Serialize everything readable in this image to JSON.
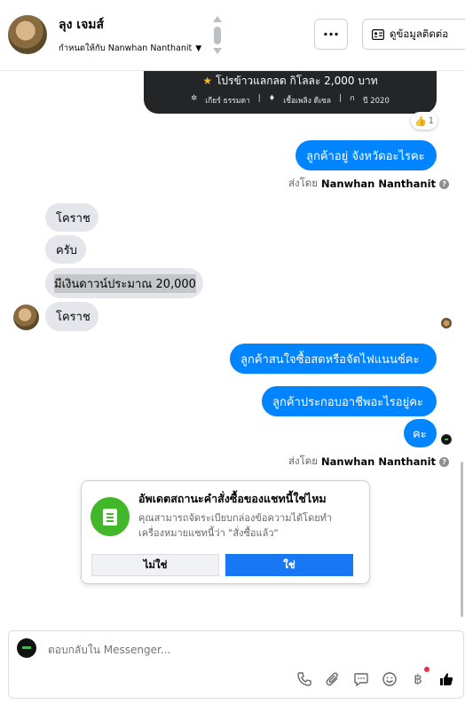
{
  "header": {
    "name": "ลุง เจมส์",
    "assigned_to": "กำหนดให้กับ Nanwhan Nanthanit",
    "more_label": "···",
    "contact_label": "ดูข้อมูลติดต่อ"
  },
  "product_card": {
    "title": "โปรข้าวแลกลด กิโลละ 2,000 บาท",
    "meta": [
      "เกียร์ ธรรมดา",
      "เชื้อเพลิง ดีเซล",
      "ปี 2020"
    ],
    "reaction_count": "1"
  },
  "messages": {
    "out_1": "ลูกค้าอยู่ จังหวัดอะไรคะ",
    "sent_by_label": "ส่งโดย",
    "sent_by_name": "Nanwhan Nanthanit",
    "in_1": "โคราช",
    "in_2": "ครับ",
    "in_3": "มีเงินดาวน์ประมาณ 20,000",
    "in_4": "โคราช",
    "out_2": "ลูกค้าสนใจซื้อสดหรือจัดไฟแนนซ์คะ",
    "out_3": "ลูกค้าประกอบอาชีพอะไรอยู่คะ",
    "out_4": "คะ"
  },
  "status_prompt": {
    "title": "อัพเดตสถานะคำสั่งซื้อของแชทนี้ใช่ไหม",
    "description": "คุณสามารถจัดระเบียบกล่องข้อความได้โดยทำเครื่องหมายแชทนี้ว่า \"สั่งซื้อแล้ว\"",
    "no_label": "ไม่ใช่",
    "yes_label": "ใช่"
  },
  "composer": {
    "placeholder": "ตอบกลับใน Messenger..."
  },
  "icons": {
    "phone": "phone-icon",
    "attach": "paperclip-icon",
    "saved_reply": "chat-bubble-icon",
    "emoji": "emoji-icon",
    "payment": "baht-icon",
    "like": "thumbs-up-icon"
  },
  "colors": {
    "outgoing": "#0084ff",
    "incoming": "#e4e6eb",
    "primary_button": "#1877f2",
    "status_icon": "#42b72a"
  }
}
